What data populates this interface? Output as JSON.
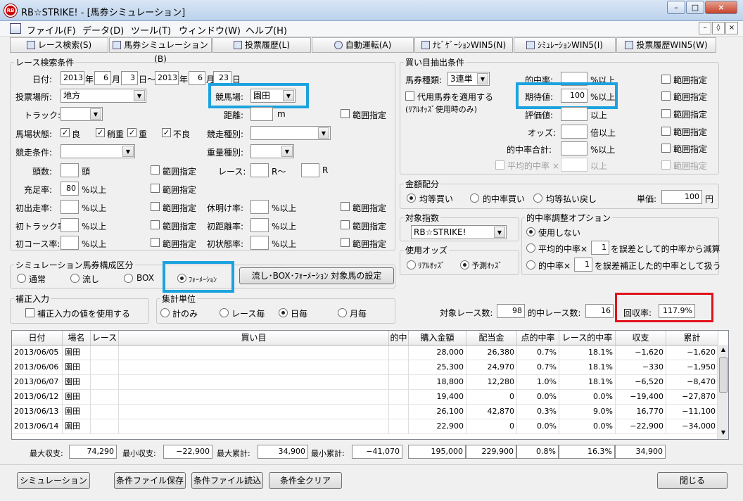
{
  "window": {
    "title": "RB☆STRIKE! - [馬券シミュレーション]",
    "icon": "app-logo-icon",
    "buttons": [
      "–",
      "□",
      "×"
    ]
  },
  "menu": [
    "ファイル(F)",
    "データ(D)",
    "ツール(T)",
    "ウィンドウ(W)",
    "ヘルプ(H)"
  ],
  "mdi_buttons": [
    "–",
    "◊",
    "×"
  ],
  "tabs": [
    "レース検索(S)",
    "馬券シミュレーション(B)",
    "投票履歴(L)",
    "自動運転(A)",
    "ﾅﾋﾞｹﾞｰｼｮﾝWIN5(N)",
    "ｼﾐｭﾚｰｼｮﾝWIN5(I)",
    "投票履歴WIN5(W)"
  ],
  "race_search": {
    "title": "レース検索条件",
    "date_label": "日付:",
    "y1": "2013",
    "nen": "年",
    "m1": "6",
    "gatsu": "月",
    "d1": "3",
    "nichi_kara": "日～",
    "y2": "2013",
    "m2": "6",
    "d2": "23",
    "nichi": "日",
    "venue_label": "投票場所:",
    "venue": "地方",
    "course_label": "競馬場:",
    "course": "園田",
    "track_label": "トラック:",
    "distance_label": "距離:",
    "distance_unit": "m",
    "range": "範囲指定",
    "cond_label": "馬場状態:",
    "cond": [
      "良",
      "稍重",
      "重",
      "不良"
    ],
    "type_label": "競走種別:",
    "race_cond_label": "競走条件:",
    "weight_label": "重量種別:",
    "heads_label": "頭数:",
    "heads_unit": "頭",
    "race_label": "レース:",
    "r_from": "R～",
    "r_to": "R",
    "fill_label": "充足率:",
    "fill_value": "80",
    "pct_over": "%以上",
    "first_run": "初出走率:",
    "rest": "休明け率:",
    "first_track": "初トラック率:",
    "first_dist": "初距離率:",
    "first_course": "初コース率:",
    "first_state": "初状態率:"
  },
  "buy_extract": {
    "title": "買い目抽出条件",
    "ticket_label": "馬券種類:",
    "ticket": "3連単",
    "alt_ticket": "代用馬券を適用する",
    "alt_note": "(ﾘｱﾙｵｯｽﾞ使用時のみ)",
    "hit_label": "的中率:",
    "pct_over": "%以上",
    "exp_label": "期待値:",
    "exp_value": "100",
    "eval_label": "評価値:",
    "over": "以上",
    "odds_label": "オッズ:",
    "odds_unit": "倍以上",
    "hit_sum_label": "的中率合計:",
    "avg_hit_label": "平均的中率 ×",
    "range": "範囲指定"
  },
  "money": {
    "title": "金額配分",
    "opts": [
      "均等買い",
      "的中率買い",
      "均等払い戻し"
    ],
    "unit_label": "単価:",
    "unit_value": "100",
    "yen": "円"
  },
  "target_index": {
    "title": "対象指数",
    "value": "RB☆STRIKE!"
  },
  "odds_used": {
    "title": "使用オッズ",
    "opts": [
      "ﾘｱﾙｵｯｽﾞ",
      "予測ｵｯｽﾞ"
    ]
  },
  "hit_adjust": {
    "title": "的中率調整オプション",
    "opt1": "使用しない",
    "opt2a": "平均的中率×",
    "opt2b": "を誤差として的中率から減算",
    "opt3a": "的中率×",
    "opt3b": "を誤差補正した的中率として扱う",
    "v2": "1",
    "v3": "1"
  },
  "sim_composition": {
    "title": "シミュレーション馬券構成区分",
    "opts": [
      "通常",
      "流し",
      "BOX",
      "ﾌｫｰﾒｰｼｮﾝ"
    ],
    "button": "流し･BOX･ﾌｫｰﾒｰｼｮﾝ 対象馬の設定"
  },
  "correction": {
    "title": "補正入力",
    "check": "補正入力の値を使用する"
  },
  "aggregate": {
    "title": "集計単位",
    "opts": [
      "計のみ",
      "レース毎",
      "日毎",
      "月毎"
    ]
  },
  "stats": {
    "races_label": "対象レース数:",
    "races": "98",
    "hit_races_label": "的中レース数:",
    "hit_races": "16",
    "recovery_label": "回収率:",
    "recovery": "117.9%"
  },
  "table": {
    "headers": [
      "日付",
      "場名",
      "レース",
      "買い目",
      "的中",
      "購入金額",
      "配当金",
      "点的中率",
      "レース的中率",
      "収支",
      "累計"
    ],
    "rows": [
      [
        "2013/06/05",
        "園田",
        "",
        "",
        "",
        "28,000",
        "26,380",
        "0.7%",
        "18.1%",
        "−1,620",
        "−1,620"
      ],
      [
        "2013/06/06",
        "園田",
        "",
        "",
        "",
        "25,300",
        "24,970",
        "0.7%",
        "18.1%",
        "−330",
        "−1,950"
      ],
      [
        "2013/06/07",
        "園田",
        "",
        "",
        "",
        "18,800",
        "12,280",
        "1.0%",
        "18.1%",
        "−6,520",
        "−8,470"
      ],
      [
        "2013/06/12",
        "園田",
        "",
        "",
        "",
        "19,400",
        "0",
        "0.0%",
        "0.0%",
        "−19,400",
        "−27,870"
      ],
      [
        "2013/06/13",
        "園田",
        "",
        "",
        "",
        "26,100",
        "42,870",
        "0.3%",
        "9.0%",
        "16,770",
        "−11,100"
      ],
      [
        "2013/06/14",
        "園田",
        "",
        "",
        "",
        "22,900",
        "0",
        "0.0%",
        "0.0%",
        "−22,900",
        "−34,000"
      ]
    ]
  },
  "summary": {
    "max_pl_label": "最大収支:",
    "max_pl": "74,290",
    "min_pl_label": "最小収支:",
    "min_pl": "−22,900",
    "max_cum_label": "最大累計:",
    "max_cum": "34,900",
    "min_cum_label": "最小累計:",
    "min_cum": "−41,070",
    "buy": "195,000",
    "pay": "229,900",
    "pt_hit": "0.8%",
    "race_hit": "16.3%",
    "pl": "34,900"
  },
  "footer": {
    "simulate": "シミュレーション",
    "save": "条件ファイル保存",
    "load": "条件ファイル読込",
    "clear": "条件全クリア",
    "close": "閉じる"
  }
}
